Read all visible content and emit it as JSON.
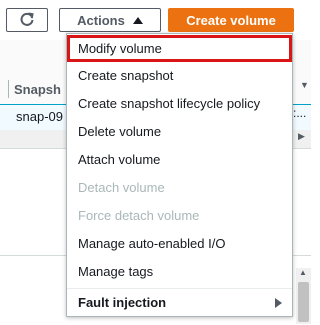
{
  "toolbar": {
    "refresh_icon": "refresh-icon",
    "actions_label": "Actions",
    "actions_caret_icon": "caret-up-icon",
    "create_label": "Create volume",
    "create_color": "#ec7211"
  },
  "table": {
    "header_snapshot": "Snapsh",
    "row_snapshot": "snap-09",
    "row_right_fragment": ":..."
  },
  "menu": {
    "items": [
      {
        "label": "Modify volume",
        "state": "highlighted"
      },
      {
        "label": "Create snapshot",
        "state": "enabled"
      },
      {
        "label": "Create snapshot lifecycle policy",
        "state": "enabled"
      },
      {
        "label": "Delete volume",
        "state": "enabled"
      },
      {
        "label": "Attach volume",
        "state": "enabled"
      },
      {
        "label": "Detach volume",
        "state": "disabled"
      },
      {
        "label": "Force detach volume",
        "state": "disabled"
      },
      {
        "label": "Manage auto-enabled I/O",
        "state": "enabled"
      },
      {
        "label": "Manage tags",
        "state": "enabled"
      }
    ],
    "group_label": "Fault injection",
    "group_caret_icon": "chevron-right-icon",
    "highlight_color": "#d91515"
  }
}
